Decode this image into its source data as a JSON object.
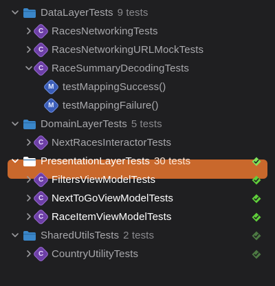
{
  "tree": [
    {
      "kind": "group",
      "name": "DataLayerTests",
      "count": "9 tests",
      "expanded": true,
      "style": "dim",
      "status": "none"
    },
    {
      "kind": "class",
      "name": "RacesNetworkingTests",
      "expanded": false,
      "style": "dim",
      "status": "none"
    },
    {
      "kind": "class",
      "name": "RacesNetworkingURLMockTests",
      "expanded": false,
      "style": "dim",
      "status": "none"
    },
    {
      "kind": "class",
      "name": "RaceSummaryDecodingTests",
      "expanded": true,
      "style": "dim",
      "status": "none"
    },
    {
      "kind": "method",
      "name": "testMappingSuccess()",
      "style": "dim",
      "status": "none"
    },
    {
      "kind": "method",
      "name": "testMappingFailure()",
      "style": "dim",
      "status": "none"
    },
    {
      "kind": "group",
      "name": "DomainLayerTests",
      "count": "5 tests",
      "expanded": true,
      "style": "dim",
      "status": "none"
    },
    {
      "kind": "class",
      "name": "NextRacesInteractorTests",
      "expanded": false,
      "style": "dim",
      "status": "none"
    },
    {
      "kind": "group",
      "name": "PresentationLayerTests",
      "count": "30 tests",
      "expanded": true,
      "style": "sel",
      "status": "pass"
    },
    {
      "kind": "class",
      "name": "FiltersViewModelTests",
      "expanded": false,
      "style": "bright",
      "status": "pass"
    },
    {
      "kind": "class",
      "name": "NextToGoViewModelTests",
      "expanded": false,
      "style": "bright",
      "status": "pass"
    },
    {
      "kind": "class",
      "name": "RaceItemViewModelTests",
      "expanded": false,
      "style": "bright",
      "status": "pass"
    },
    {
      "kind": "group",
      "name": "SharedUtilsTests",
      "count": "2 tests",
      "expanded": true,
      "style": "dim",
      "status": "pass-dim"
    },
    {
      "kind": "class",
      "name": "CountryUtilityTests",
      "expanded": false,
      "style": "dim",
      "status": "pass-dim"
    }
  ],
  "icons": {
    "group": "folder-icon",
    "class": "class-c-icon",
    "method": "method-m-icon",
    "pass": "checkmark-icon"
  },
  "badge_letters": {
    "class": "C",
    "method": "M"
  },
  "colors": {
    "selection": "#c9682c",
    "pass": "#5fcf3a",
    "pass_dim": "#4d7a43",
    "folder": "#3a86c9"
  }
}
